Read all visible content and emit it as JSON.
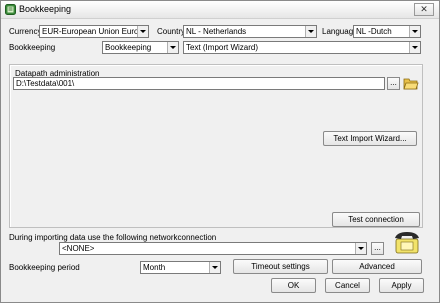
{
  "window": {
    "title": "Bookkeeping",
    "close_glyph": "✕"
  },
  "icons": {
    "title": "ledger-icon",
    "folder": "open-folder-icon",
    "phone": "telephone-icon"
  },
  "currency": {
    "label": "Currency",
    "value": "EUR-European Union Euro"
  },
  "country": {
    "label": "Country",
    "value": "NL - Netherlands"
  },
  "language": {
    "label": "Language",
    "value": "NL -Dutch"
  },
  "bookkeeping": {
    "label": "Bookkeeping",
    "type_value": "Bookkeeping",
    "import_value": "Text (Import Wizard)"
  },
  "datapath": {
    "group_label": "Datapath administration",
    "path_value": "D:\\Testdata\\001\\",
    "browse_label": "...",
    "wizard_button": "Text Import Wizard..."
  },
  "test_connection_button": "Test connection",
  "network": {
    "label": "During importing data use the following networkconnection",
    "value": "<NONE>",
    "browse_label": "..."
  },
  "period": {
    "label": "Bookkeeping period",
    "value": "Month"
  },
  "buttons": {
    "timeout": "Timeout settings",
    "advanced": "Advanced",
    "ok": "OK",
    "cancel": "Cancel",
    "apply": "Apply"
  }
}
